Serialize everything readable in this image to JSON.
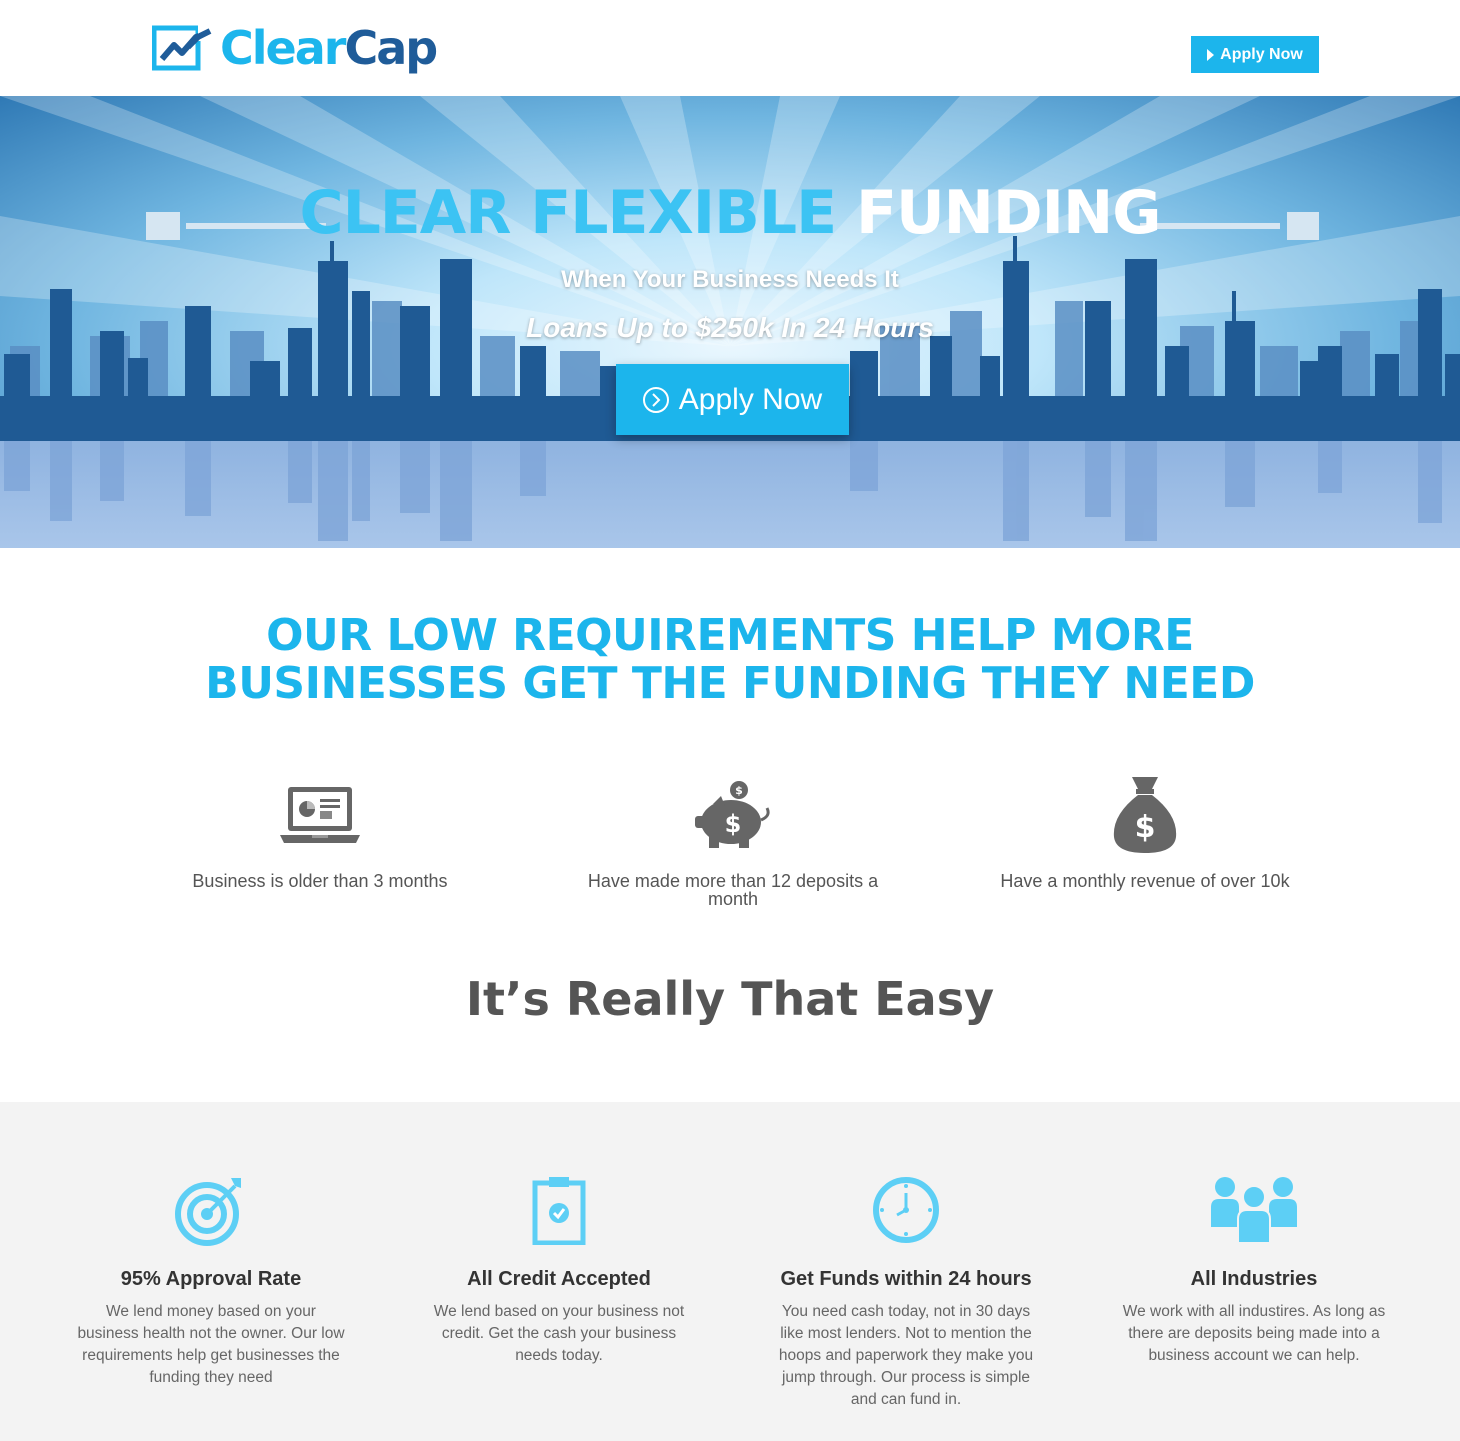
{
  "header": {
    "logo_clear": "Clear",
    "logo_cap": "Cap",
    "apply_label": "Apply Now"
  },
  "hero": {
    "title_part1": "CLEAR FLEXIBLE",
    "title_part2": "FUNDING",
    "subtitle": "When Your Business Needs It",
    "subtitle2": "Loans Up to $250k In 24 Hours",
    "cta_label": "Apply Now"
  },
  "requirements": {
    "title_line1": "OUR LOW REQUIREMENTS HELP MORE",
    "title_line2": "BUSINESSES GET THE FUNDING THEY NEED",
    "items": [
      {
        "icon": "laptop-chart-icon",
        "text": "Business is older than 3 months"
      },
      {
        "icon": "piggy-bank-icon",
        "text": "Have made more than 12 deposits a month"
      },
      {
        "icon": "money-bag-icon",
        "text": "Have a monthly revenue of over 10k"
      }
    ]
  },
  "easy": {
    "title": "It’s Really That Easy"
  },
  "features": [
    {
      "icon": "target-icon",
      "title": "95% Approval Rate",
      "text": "We lend money based on your business health not the owner. Our low requirements help get businesses the funding they need"
    },
    {
      "icon": "clipboard-check-icon",
      "title": "All Credit Accepted",
      "text": "We lend based on your business not credit. Get the cash your business needs today."
    },
    {
      "icon": "clock-icon",
      "title": "Get Funds within 24 hours",
      "text": "You need cash today, not in 30 days like most lenders. Not to mention the hoops and paperwork they make you jump through. Our process is simple and can fund in."
    },
    {
      "icon": "group-people-icon",
      "title": "All Industries",
      "text": "We work with all industires. As long as there are deposits being made into a business account we can help."
    }
  ],
  "colors": {
    "accent": "#1cb5ec",
    "brand_dark": "#1f5c99",
    "text_gray": "#555555",
    "feature_bg": "#f3f3f3",
    "icon_light_blue": "#5dcff5",
    "icon_gray": "#666666"
  }
}
